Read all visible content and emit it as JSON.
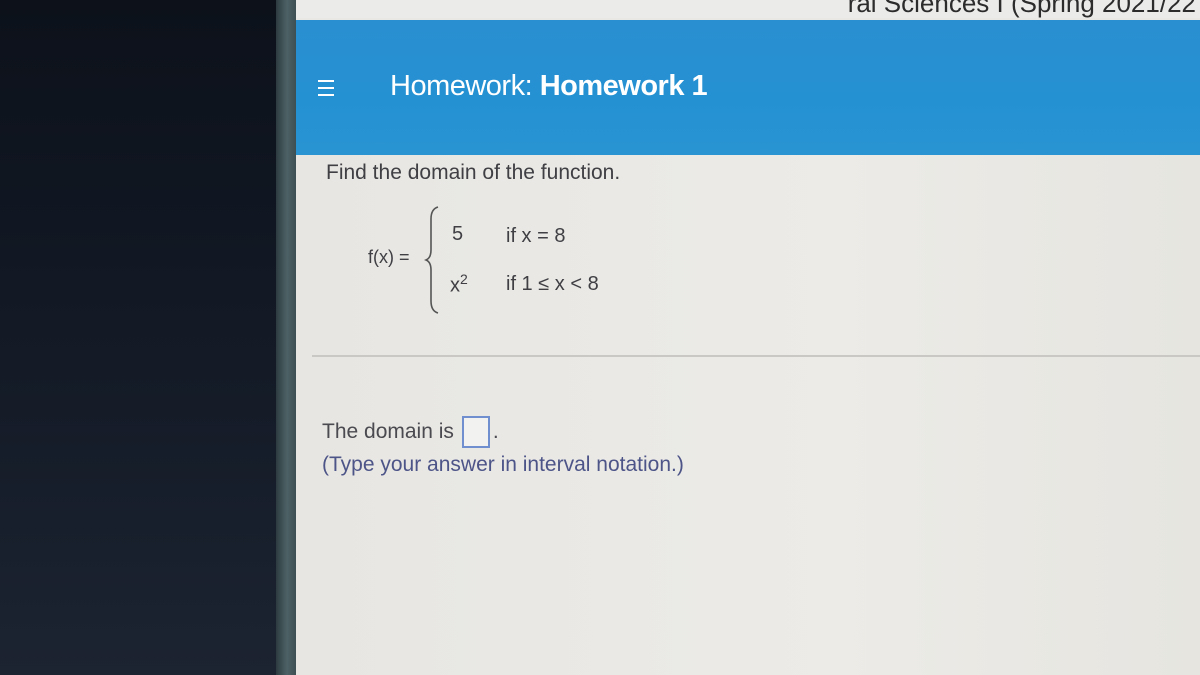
{
  "browser": {
    "course_title_partial": "ral Sciences I (Spring 2021/22"
  },
  "header": {
    "menu_icon": "hamburger-menu-icon",
    "title_prefix": "Homework:",
    "title_name": "Homework 1",
    "background_color": "#2491d3"
  },
  "question": {
    "prompt": "Find the domain of the function.",
    "function_label": "f(x) =",
    "cases": [
      {
        "value": "5",
        "exponent": "",
        "condition": "if  x = 8"
      },
      {
        "value": "x",
        "exponent": "2",
        "condition": "if  1 ≤ x < 8"
      }
    ]
  },
  "answer": {
    "prefix": "The domain is",
    "input_value": "",
    "suffix": ".",
    "hint": "(Type your answer in interval notation.)",
    "box_border_color": "#6f8fcf"
  }
}
